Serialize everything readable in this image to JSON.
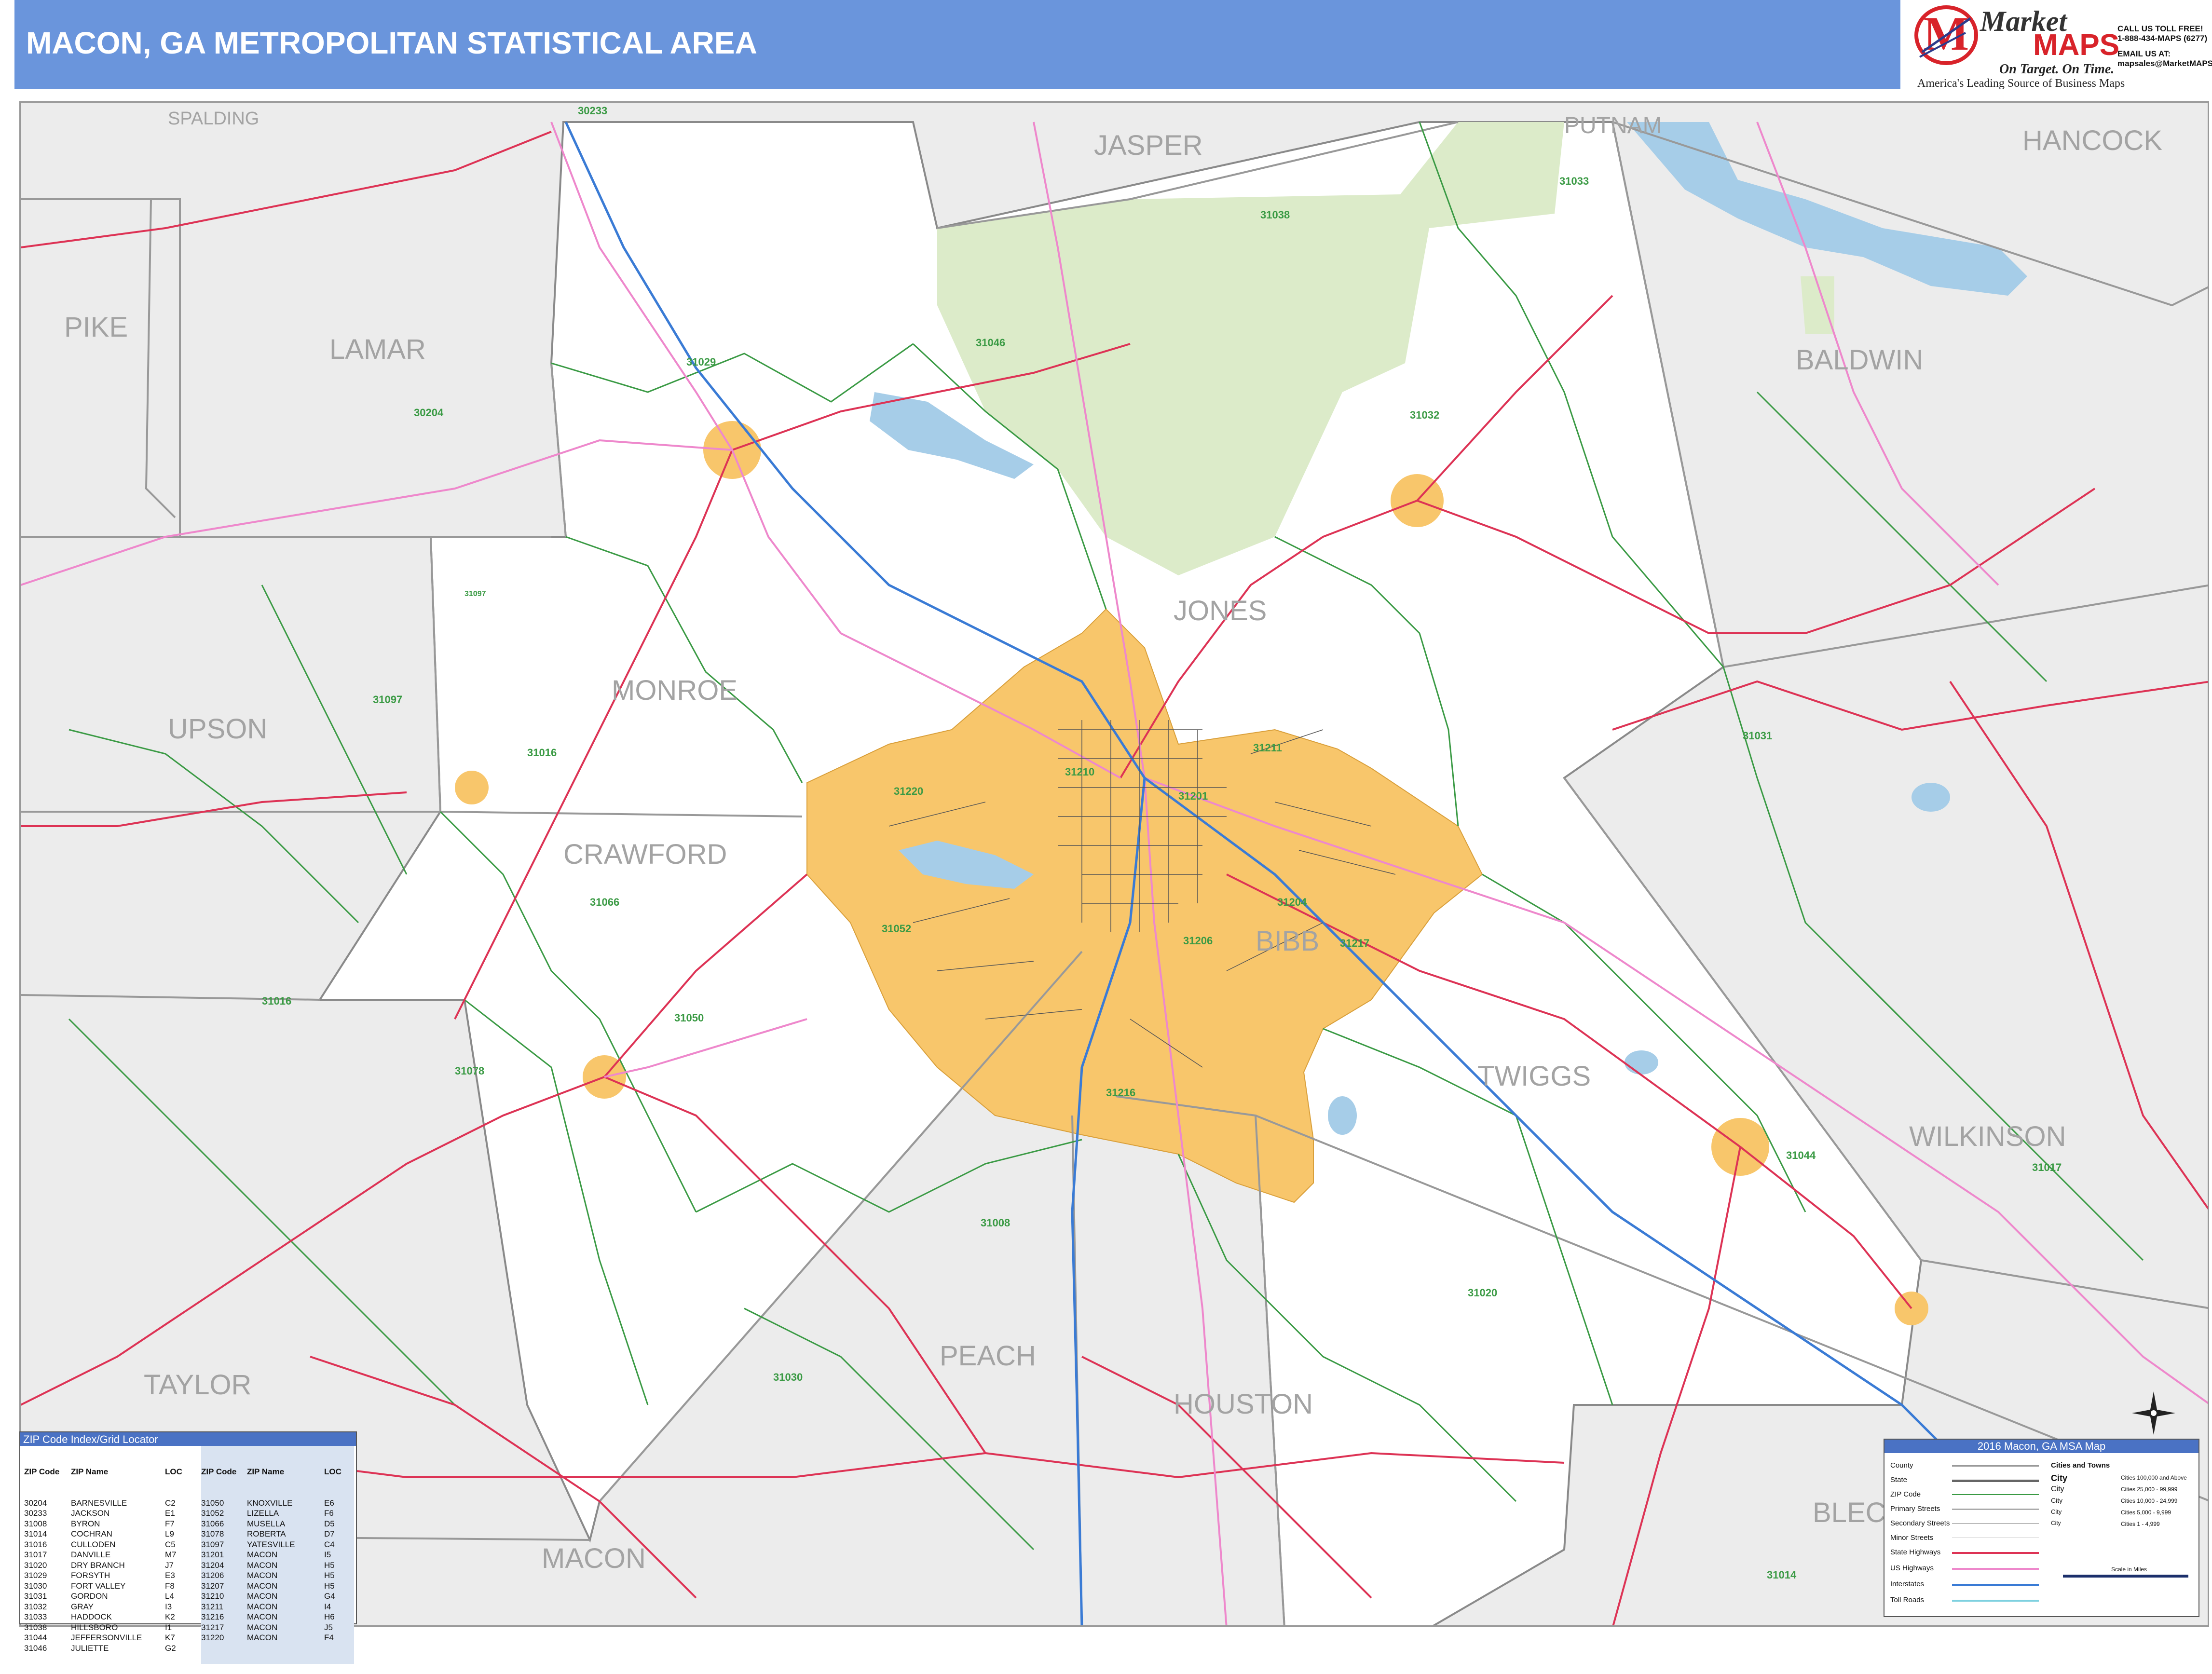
{
  "header": {
    "title": "MACON, GA METROPOLITAN STATISTICAL AREA"
  },
  "logo": {
    "market": "Market",
    "maps": "MAPS",
    "tagline": "On Target. On Time.",
    "subtitle": "America's Leading Source of Business Maps",
    "contact_lines": [
      "CALL US TOLL FREE!",
      "1-888-434-MAPS (6277)",
      "EMAIL US AT:",
      "mapsales@MarketMAPS.com"
    ]
  },
  "colors": {
    "title_bar": "#6a95dc",
    "metro_fill": "#f8c66b",
    "forest": "#dcebc9",
    "water": "#a6cde8",
    "msa_area": "#ffffff",
    "outside": "#ececec",
    "zip_boundary": "#3a9a44",
    "state_highway": "#dd3355",
    "us_highway": "#ee88cc",
    "interstate": "#3a7bd5",
    "county_border": "#999999"
  },
  "map": {
    "counties": [
      {
        "name": "SPALDING"
      },
      {
        "name": "JASPER"
      },
      {
        "name": "PUTNAM"
      },
      {
        "name": "HANCOCK"
      },
      {
        "name": "PIKE"
      },
      {
        "name": "LAMAR"
      },
      {
        "name": "BALDWIN"
      },
      {
        "name": "JONES"
      },
      {
        "name": "MONROE"
      },
      {
        "name": "UPSON"
      },
      {
        "name": "CRAWFORD"
      },
      {
        "name": "BIBB"
      },
      {
        "name": "TWIGGS"
      },
      {
        "name": "WILKINSON"
      },
      {
        "name": "TAYLOR"
      },
      {
        "name": "PEACH"
      },
      {
        "name": "HOUSTON"
      },
      {
        "name": "MACON"
      },
      {
        "name": "BLECKLEY"
      }
    ],
    "zip_labels": [
      "30233",
      "31033",
      "31038",
      "31046",
      "31029",
      "30204",
      "31032",
      "31097",
      "31097",
      "31016",
      "31211",
      "31210",
      "31220",
      "31201",
      "31066",
      "31052",
      "31204",
      "31206",
      "31217",
      "31031",
      "31016",
      "31050",
      "31078",
      "31216",
      "31044",
      "31017",
      "31008",
      "31020",
      "31030",
      "31014"
    ]
  },
  "zip_index": {
    "title": "ZIP Code Index/Grid Locator",
    "headers": [
      "ZIP Code",
      "ZIP Name",
      "LOC",
      "ZIP Code",
      "ZIP Name",
      "LOC"
    ],
    "left": [
      [
        "30204",
        "BARNESVILLE",
        "C2"
      ],
      [
        "30233",
        "JACKSON",
        "E1"
      ],
      [
        "31008",
        "BYRON",
        "F7"
      ],
      [
        "31014",
        "COCHRAN",
        "L9"
      ],
      [
        "31016",
        "CULLODEN",
        "C5"
      ],
      [
        "31017",
        "DANVILLE",
        "M7"
      ],
      [
        "31020",
        "DRY BRANCH",
        "J7"
      ],
      [
        "31029",
        "FORSYTH",
        "E3"
      ],
      [
        "31030",
        "FORT VALLEY",
        "F8"
      ],
      [
        "31031",
        "GORDON",
        "L4"
      ],
      [
        "31032",
        "GRAY",
        "I3"
      ],
      [
        "31033",
        "HADDOCK",
        "K2"
      ],
      [
        "31038",
        "HILLSBORO",
        "I1"
      ],
      [
        "31044",
        "JEFFERSONVILLE",
        "K7"
      ],
      [
        "31046",
        "JULIETTE",
        "G2"
      ]
    ],
    "right": [
      [
        "31050",
        "KNOXVILLE",
        "E6"
      ],
      [
        "31052",
        "LIZELLA",
        "F6"
      ],
      [
        "31066",
        "MUSELLA",
        "D5"
      ],
      [
        "31078",
        "ROBERTA",
        "D7"
      ],
      [
        "31097",
        "YATESVILLE",
        "C4"
      ],
      [
        "31201",
        "MACON",
        "I5"
      ],
      [
        "31204",
        "MACON",
        "H5"
      ],
      [
        "31206",
        "MACON",
        "H5"
      ],
      [
        "31207",
        "MACON",
        "H5"
      ],
      [
        "31210",
        "MACON",
        "G4"
      ],
      [
        "31211",
        "MACON",
        "I4"
      ],
      [
        "31216",
        "MACON",
        "H6"
      ],
      [
        "31217",
        "MACON",
        "J5"
      ],
      [
        "31220",
        "MACON",
        "F4"
      ]
    ]
  },
  "legend": {
    "title": "2016 Macon, GA MSA Map",
    "items": [
      "County",
      "State",
      "ZIP Code",
      "Primary Streets",
      "Secondary Streets",
      "Minor Streets",
      "State Highways",
      "US Highways",
      "Interstates",
      "Toll Roads"
    ],
    "cities_header": "Cities and Towns",
    "cities": [
      {
        "label": "City",
        "range": "Cities 100,000 and Above"
      },
      {
        "label": "City",
        "range": "Cities 25,000 - 99,999"
      },
      {
        "label": "City",
        "range": "Cities 10,000 - 24,999"
      },
      {
        "label": "City",
        "range": "Cities 5,000 - 9,999"
      },
      {
        "label": "City",
        "range": "Cities 1 - 4,999"
      }
    ],
    "scale_title": "Scale in Miles"
  }
}
